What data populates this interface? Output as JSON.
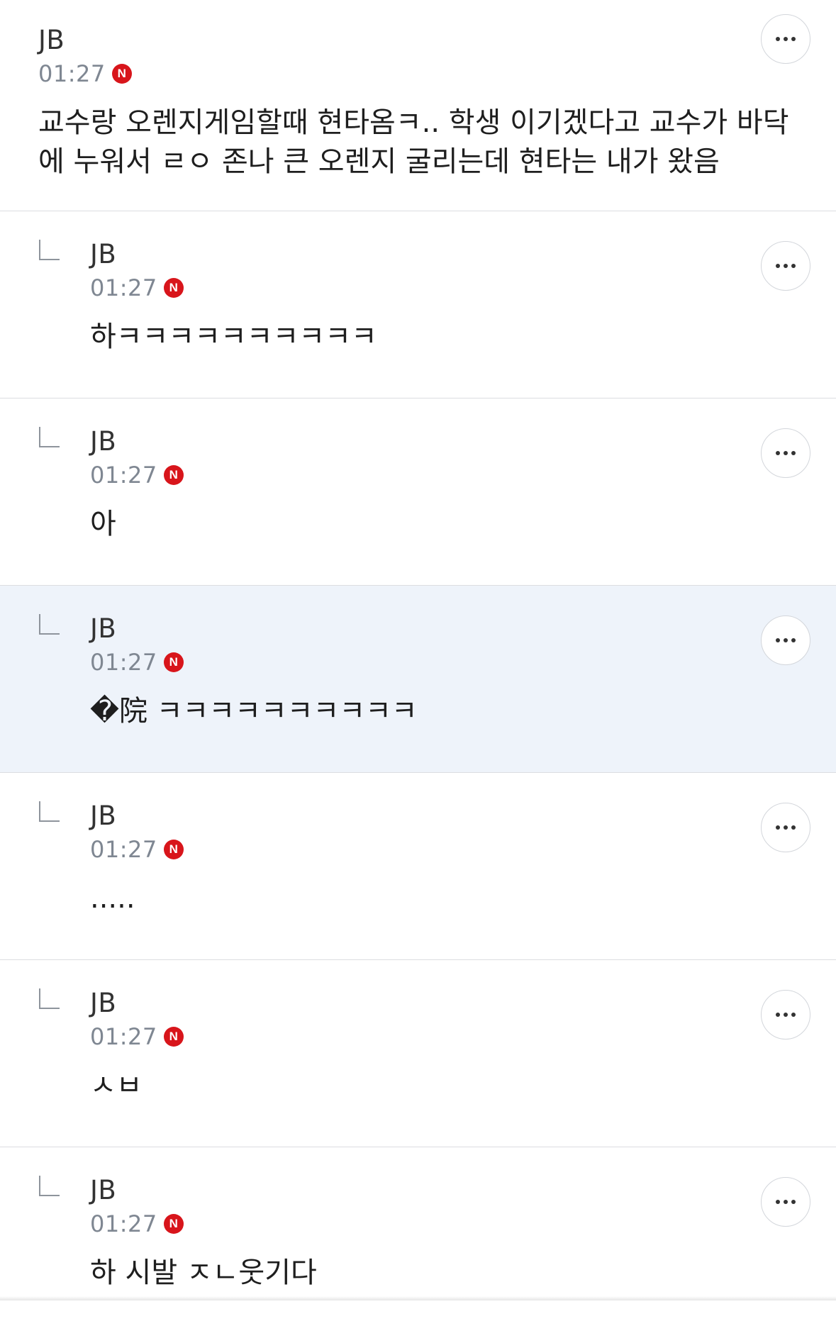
{
  "comments": [
    {
      "author": "JB",
      "time": "01:27",
      "badge": "N",
      "text": "교수랑 오렌지게임할때 현타옴ㅋ.. 학생 이기겠다고 교수가 바닥에 누워서 ㄹㅇ 존나 큰 오렌지 굴리는데 현타는 내가 왔음",
      "more_icon": "more-horizontal-icon"
    }
  ],
  "replies": [
    {
      "author": "JB",
      "time": "01:27",
      "badge": "N",
      "text": "하ㅋㅋㅋㅋㅋㅋㅋㅋㅋㅋ",
      "highlighted": false
    },
    {
      "author": "JB",
      "time": "01:27",
      "badge": "N",
      "text": "아",
      "highlighted": false
    },
    {
      "author": "JB",
      "time": "01:27",
      "badge": "N",
      "text": "�院 ㅋㅋㅋㅋㅋㅋㅋㅋㅋㅋ",
      "highlighted": true
    },
    {
      "author": "JB",
      "time": "01:27",
      "badge": "N",
      "text": ".....",
      "highlighted": false
    },
    {
      "author": "JB",
      "time": "01:27",
      "badge": "N",
      "text": "ㅅㅂ",
      "highlighted": false
    },
    {
      "author": "JB",
      "time": "01:27",
      "badge": "N",
      "text": "하 시발 ㅈㄴ웃기다",
      "highlighted": false
    }
  ],
  "colors": {
    "badge": "#d8151b",
    "highlight_bg": "#eef3fa",
    "time": "#7f8792",
    "divider": "#dcdde1"
  },
  "icons": {
    "reply": "reply-arrow-icon",
    "more": "more-horizontal-icon",
    "badge": "naver-n-badge-icon"
  }
}
